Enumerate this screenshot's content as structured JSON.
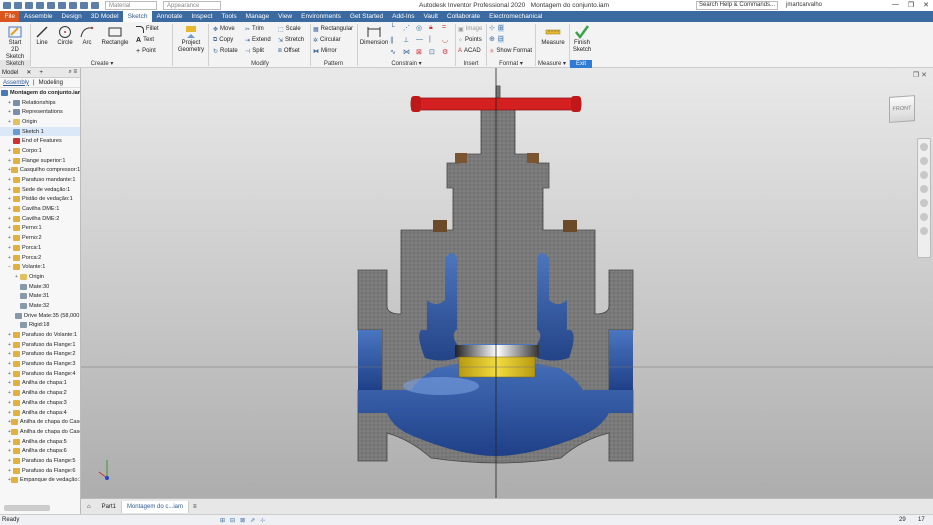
{
  "titlebar": {
    "material": "Material",
    "appearance": "Appearance",
    "app_title": "Autodesk Inventor Professional 2020",
    "doc_title": "Montagem do conjunto.iam",
    "search_placeholder": "Search Help & Commands...",
    "user": "jmartcarvalho"
  },
  "tabs": [
    "File",
    "Assemble",
    "Design",
    "3D Model",
    "Sketch",
    "Annotate",
    "Inspect",
    "Tools",
    "Manage",
    "View",
    "Environments",
    "Get Started",
    "Add-Ins",
    "Vault",
    "Collaborate",
    "Electromechanical"
  ],
  "ribbon": {
    "sketch": {
      "start": "Start",
      "start2": "2D Sketch",
      "group": "Sketch"
    },
    "create": {
      "line": "Line",
      "circle": "Circle",
      "arc": "Arc",
      "rectangle": "Rectangle",
      "fillet": "Fillet",
      "text": "Text",
      "point": "Point",
      "group": "Create"
    },
    "project": {
      "l1": "Project",
      "l2": "Geometry"
    },
    "modify": {
      "move": "Move",
      "trim": "Trim",
      "scale": "Scale",
      "copy": "Copy",
      "extend": "Extend",
      "stretch": "Stretch",
      "rotate": "Rotate",
      "split": "Split",
      "offset": "Offset",
      "group": "Modify"
    },
    "pattern": {
      "rectangular": "Rectangular",
      "circular": "Circular",
      "mirror": "Mirror",
      "group": "Pattern"
    },
    "constrain": {
      "dimension": "Dimension",
      "group": "Constrain"
    },
    "insert": {
      "image": "Image",
      "points": "Points",
      "acad": "ACAD",
      "group": "Insert"
    },
    "format": {
      "show_format": "Show Format",
      "group": "Format"
    },
    "measure": {
      "label": "Measure",
      "group": "Measure"
    },
    "exit": {
      "l1": "Finish",
      "l2": "Sketch",
      "group": "Exit"
    }
  },
  "browser": {
    "model_tab": "Model",
    "assembly_tab": "Assembly",
    "modeling_tab": "Modeling",
    "nodes": [
      {
        "label": "Montagem do conjunto.iam",
        "indent": 0,
        "tg": "",
        "icon": "assembly-icon",
        "color": "#4a78b5",
        "bold": true
      },
      {
        "label": "Relationships",
        "indent": 1,
        "tg": "+",
        "icon": "relationships-icon",
        "color": "#7a8ea8"
      },
      {
        "label": "Representations",
        "indent": 1,
        "tg": "+",
        "icon": "representations-icon",
        "color": "#7a8ea8"
      },
      {
        "label": "Origin",
        "indent": 1,
        "tg": "+",
        "icon": "folder-icon",
        "color": "#e0c060"
      },
      {
        "label": "Sketch 1",
        "indent": 1,
        "tg": "",
        "icon": "sketch-icon",
        "color": "#6a9ad0",
        "selected": true
      },
      {
        "label": "End of Features",
        "indent": 1,
        "tg": "",
        "icon": "end-of-features-icon",
        "color": "#c33"
      },
      {
        "label": "Corpo:1",
        "indent": 1,
        "tg": "+",
        "icon": "part-icon",
        "color": "#e0b040"
      },
      {
        "label": "Flange superior:1",
        "indent": 1,
        "tg": "+",
        "icon": "part-icon",
        "color": "#e0b040"
      },
      {
        "label": "Casquilho compressor:1",
        "indent": 1,
        "tg": "+",
        "icon": "part-icon",
        "color": "#e0b040"
      },
      {
        "label": "Parafuso mandante:1",
        "indent": 1,
        "tg": "+",
        "icon": "part-icon",
        "color": "#e0b040"
      },
      {
        "label": "Sede de vedação:1",
        "indent": 1,
        "tg": "+",
        "icon": "part-icon",
        "color": "#e0b040"
      },
      {
        "label": "Pistão de vedação:1",
        "indent": 1,
        "tg": "+",
        "icon": "part-icon",
        "color": "#e0b040"
      },
      {
        "label": "Cavilha DME:1",
        "indent": 1,
        "tg": "+",
        "icon": "part-icon",
        "color": "#e0b040"
      },
      {
        "label": "Cavilha DME:2",
        "indent": 1,
        "tg": "+",
        "icon": "part-icon",
        "color": "#e0b040"
      },
      {
        "label": "Perno:1",
        "indent": 1,
        "tg": "+",
        "icon": "part-icon",
        "color": "#e0b040"
      },
      {
        "label": "Perno:2",
        "indent": 1,
        "tg": "+",
        "icon": "part-icon",
        "color": "#e0b040"
      },
      {
        "label": "Porca:1",
        "indent": 1,
        "tg": "+",
        "icon": "part-icon",
        "color": "#e0b040"
      },
      {
        "label": "Porca:2",
        "indent": 1,
        "tg": "+",
        "icon": "part-icon",
        "color": "#e0b040"
      },
      {
        "label": "Volante:1",
        "indent": 1,
        "tg": "−",
        "icon": "part-icon",
        "color": "#e0b040"
      },
      {
        "label": "Origin",
        "indent": 2,
        "tg": "+",
        "icon": "folder-icon",
        "color": "#e0c060"
      },
      {
        "label": "Mate:30",
        "indent": 2,
        "tg": "",
        "icon": "mate-icon",
        "color": "#8899aa"
      },
      {
        "label": "Mate:31",
        "indent": 2,
        "tg": "",
        "icon": "mate-icon",
        "color": "#8899aa"
      },
      {
        "label": "Mate:32",
        "indent": 2,
        "tg": "",
        "icon": "mate-icon",
        "color": "#8899aa"
      },
      {
        "label": "Drive Mate:35 (58,000 deg)",
        "indent": 2,
        "tg": "",
        "icon": "drive-mate-icon",
        "color": "#8899aa"
      },
      {
        "label": "Rigid:18",
        "indent": 2,
        "tg": "",
        "icon": "rigid-icon",
        "color": "#8899aa"
      },
      {
        "label": "Parafuso do Volante:1",
        "indent": 1,
        "tg": "+",
        "icon": "part-icon",
        "color": "#e0b040"
      },
      {
        "label": "Parafuso da Flange:1",
        "indent": 1,
        "tg": "+",
        "icon": "part-icon",
        "color": "#e0b040"
      },
      {
        "label": "Parafuso da Flange:2",
        "indent": 1,
        "tg": "+",
        "icon": "part-icon",
        "color": "#e0b040"
      },
      {
        "label": "Parafuso da Flange:3",
        "indent": 1,
        "tg": "+",
        "icon": "part-icon",
        "color": "#e0b040"
      },
      {
        "label": "Parafuso da Flange:4",
        "indent": 1,
        "tg": "+",
        "icon": "part-icon",
        "color": "#e0b040"
      },
      {
        "label": "Anilha de chapa:1",
        "indent": 1,
        "tg": "+",
        "icon": "part-icon",
        "color": "#e0b040"
      },
      {
        "label": "Anilha de chapa:2",
        "indent": 1,
        "tg": "+",
        "icon": "part-icon",
        "color": "#e0b040"
      },
      {
        "label": "Anilha de chapa:3",
        "indent": 1,
        "tg": "+",
        "icon": "part-icon",
        "color": "#e0b040"
      },
      {
        "label": "Anilha de chapa:4",
        "indent": 1,
        "tg": "+",
        "icon": "part-icon",
        "color": "#e0b040"
      },
      {
        "label": "Anilha de chapa do Casquilho:1",
        "indent": 1,
        "tg": "+",
        "icon": "part-icon",
        "color": "#e0b040"
      },
      {
        "label": "Anilha de chapa do Casquilho:2",
        "indent": 1,
        "tg": "+",
        "icon": "part-icon",
        "color": "#e0b040"
      },
      {
        "label": "Anilha de chapa:5",
        "indent": 1,
        "tg": "+",
        "icon": "part-icon",
        "color": "#e0b040"
      },
      {
        "label": "Anilha de chapa:6",
        "indent": 1,
        "tg": "+",
        "icon": "part-icon",
        "color": "#e0b040"
      },
      {
        "label": "Parafuso da Flange:5",
        "indent": 1,
        "tg": "+",
        "icon": "part-icon",
        "color": "#e0b040"
      },
      {
        "label": "Parafuso da Flange:6",
        "indent": 1,
        "tg": "+",
        "icon": "part-icon",
        "color": "#e0b040"
      },
      {
        "label": "Empanque de vedação:1",
        "indent": 1,
        "tg": "+",
        "icon": "part-icon",
        "color": "#e0b040"
      }
    ]
  },
  "viewcube": {
    "face": "FRONT"
  },
  "doctabs": [
    "Part1",
    "Montagem do c...iam"
  ],
  "status": {
    "text": "Ready",
    "count1": "29",
    "count2": "17"
  },
  "colors": {
    "accent": "#3b6aa0",
    "file_tab": "#d9571f",
    "steel": "#7c7c7c",
    "fluid": "#2f5aa8",
    "handwheel": "#d42020",
    "brass": "#d8b818"
  }
}
